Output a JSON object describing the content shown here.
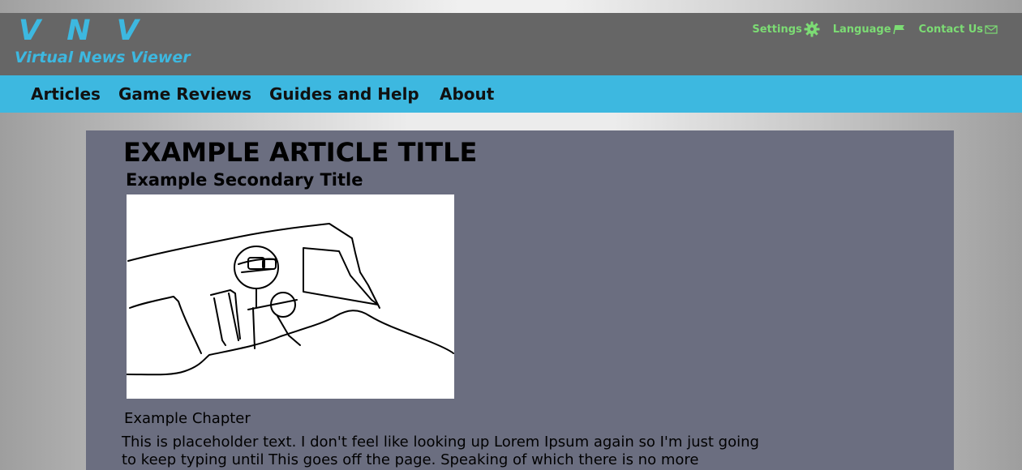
{
  "header": {
    "logo": "V N V",
    "tagline": "Virtual News Viewer",
    "links": {
      "settings": "Settings",
      "language": "Language",
      "contact": "Contact Us"
    }
  },
  "nav": {
    "articles": "Articles",
    "game_reviews": "Game Reviews",
    "guides": "Guides and Help",
    "about": "About"
  },
  "article": {
    "title": "EXAMPLE ARTICLE TITLE",
    "secondary_title": "Example Secondary Title",
    "chapter": "Example Chapter",
    "body": "This is placeholder text. I don't feel like looking up Lorem Ipsum again so I'm just going to keep typing until This goes off the page. Speaking of which there is no more"
  },
  "colors": {
    "accent": "#3db8e0",
    "header_bg": "#666666",
    "content_bg": "#6b6e80",
    "link_green": "#7cdc74"
  },
  "icons": {
    "settings": "gear-icon",
    "language": "flag-icon",
    "contact": "envelope-icon"
  }
}
